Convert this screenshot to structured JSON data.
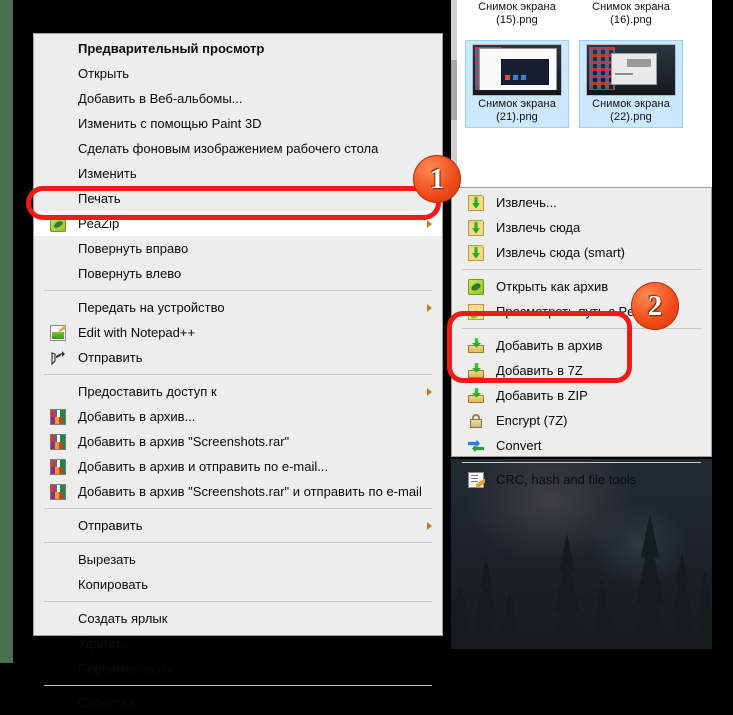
{
  "theme": {
    "menu_bg": "#ededed",
    "menu_border": "#a0a0a0",
    "selection_blue": "#cce8ff",
    "annotation_red": "#f01b16",
    "badge_orange": "#ef4b18",
    "wallpaper_dark": "#1b2228",
    "desktop_green": "#4a7050"
  },
  "files_pane": {
    "tiles": [
      {
        "name_line1": "Снимок экрана",
        "name_line2": "(15).png",
        "selected": false
      },
      {
        "name_line1": "Снимок экрана",
        "name_line2": "(16).png",
        "selected": false
      },
      {
        "name_line1": "Снимок экрана",
        "name_line2": "(21).png",
        "selected": true
      },
      {
        "name_line1": "Снимок экрана",
        "name_line2": "(22).png",
        "selected": true
      }
    ]
  },
  "context_menu": {
    "name": "file-context-menu",
    "items": [
      {
        "label": "Предварительный просмотр",
        "bold": true,
        "icon": null,
        "arrow": false,
        "highlighted": false
      },
      {
        "label": "Открыть",
        "bold": false,
        "icon": null,
        "arrow": false,
        "highlighted": false
      },
      {
        "label": "Добавить в Веб-альбомы...",
        "bold": false,
        "icon": null,
        "arrow": false,
        "highlighted": false
      },
      {
        "label": "Изменить с помощью Paint 3D",
        "bold": false,
        "icon": null,
        "arrow": false,
        "highlighted": false
      },
      {
        "label": "Сделать фоновым изображением рабочего стола",
        "bold": false,
        "icon": null,
        "arrow": false,
        "highlighted": false
      },
      {
        "label": "Изменить",
        "bold": false,
        "icon": null,
        "arrow": false,
        "highlighted": false
      },
      {
        "label": "Печать",
        "bold": false,
        "icon": null,
        "arrow": false,
        "highlighted": false
      },
      {
        "label": "PeaZip",
        "bold": false,
        "icon": "peazip-icon",
        "arrow": true,
        "highlighted": true
      },
      {
        "label": "Повернуть вправо",
        "bold": false,
        "icon": null,
        "arrow": false,
        "highlighted": false
      },
      {
        "label": "Повернуть влево",
        "bold": false,
        "icon": null,
        "arrow": false,
        "highlighted": false
      },
      {
        "separator": true
      },
      {
        "label": "Передать на устройство",
        "bold": false,
        "icon": null,
        "arrow": true,
        "highlighted": false
      },
      {
        "label": "Edit with Notepad++",
        "bold": false,
        "icon": "notepadpp-icon",
        "arrow": false,
        "highlighted": false
      },
      {
        "label": "Отправить",
        "bold": false,
        "icon": "share-icon",
        "arrow": false,
        "highlighted": false
      },
      {
        "separator": true
      },
      {
        "label": "Предоставить доступ к",
        "bold": false,
        "icon": null,
        "arrow": true,
        "highlighted": false
      },
      {
        "label": "Добавить в архив...",
        "bold": false,
        "icon": "winrar-icon",
        "arrow": false,
        "highlighted": false
      },
      {
        "label": "Добавить в архив \"Screenshots.rar\"",
        "bold": false,
        "icon": "winrar-icon",
        "arrow": false,
        "highlighted": false
      },
      {
        "label": "Добавить в архив и отправить по e-mail...",
        "bold": false,
        "icon": "winrar-icon",
        "arrow": false,
        "highlighted": false
      },
      {
        "label": "Добавить в архив \"Screenshots.rar\" и отправить по e-mail",
        "bold": false,
        "icon": "winrar-icon",
        "arrow": false,
        "highlighted": false
      },
      {
        "separator": true
      },
      {
        "label": "Отправить",
        "bold": false,
        "icon": null,
        "arrow": true,
        "highlighted": false
      },
      {
        "separator": true
      },
      {
        "label": "Вырезать",
        "bold": false,
        "icon": null,
        "arrow": false,
        "highlighted": false
      },
      {
        "label": "Копировать",
        "bold": false,
        "icon": null,
        "arrow": false,
        "highlighted": false
      },
      {
        "separator": true
      },
      {
        "label": "Создать ярлык",
        "bold": false,
        "icon": null,
        "arrow": false,
        "highlighted": false
      },
      {
        "label": "Удалить",
        "bold": false,
        "icon": null,
        "arrow": false,
        "highlighted": false
      },
      {
        "label": "Переименовать",
        "bold": false,
        "icon": null,
        "arrow": false,
        "highlighted": false
      },
      {
        "separator": true
      },
      {
        "label": "Свойства",
        "bold": false,
        "icon": null,
        "arrow": false,
        "highlighted": false
      }
    ]
  },
  "peazip_submenu": {
    "name": "peazip-submenu",
    "items": [
      {
        "label": "Извлечь...",
        "icon": "extract-icon"
      },
      {
        "label": "Извлечь сюда",
        "icon": "extract-icon"
      },
      {
        "label": "Извлечь сюда (smart)",
        "icon": "extract-icon"
      },
      {
        "separator": true
      },
      {
        "label": "Открыть как архив",
        "icon": "archive-open-icon"
      },
      {
        "label": "Просмотреть путь с PeaZip",
        "icon": "browse-path-icon"
      },
      {
        "separator": true
      },
      {
        "label": "Добавить в архив",
        "icon": "add-archive-icon"
      },
      {
        "label": "Добавить в 7Z",
        "icon": "add-archive-icon"
      },
      {
        "label": "Добавить в ZIP",
        "icon": "add-archive-icon"
      },
      {
        "label": "Encrypt (7Z)",
        "icon": "lock-icon"
      },
      {
        "label": "Convert",
        "icon": "convert-icon"
      },
      {
        "separator": true
      },
      {
        "label": "CRC, hash and file tools",
        "icon": "crc-tools-icon"
      }
    ]
  },
  "annotations": {
    "badges": [
      {
        "number": "1",
        "target": "PeaZip"
      },
      {
        "number": "2",
        "target": "Добавить в архив / 7Z / ZIP"
      }
    ]
  }
}
